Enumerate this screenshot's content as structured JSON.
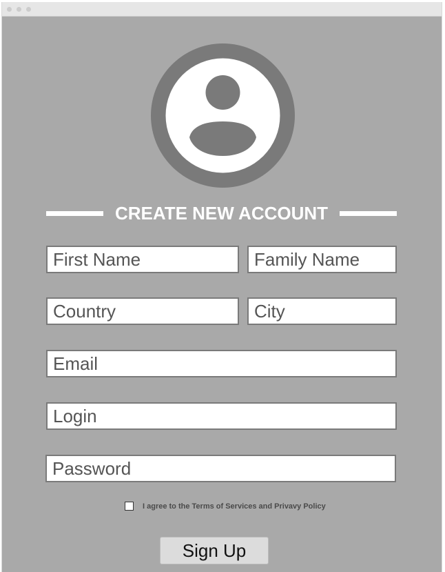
{
  "heading": "CREATE NEW ACCOUNT",
  "fields": {
    "first_name": "First Name",
    "family_name": "Family Name",
    "country": "Country",
    "city": "City",
    "email": "Email",
    "login": "Login",
    "password": "Password"
  },
  "agree_text": "I agree to the Terms of Services and Privavy Policy",
  "agree_checked": false,
  "signup_label": "Sign Up",
  "icons": {
    "avatar": "user-avatar-icon"
  },
  "colors": {
    "background": "#a9a9a9",
    "avatar_ring": "#7a7a7a",
    "field_border": "#7a7a7a",
    "heading": "#ffffff"
  }
}
